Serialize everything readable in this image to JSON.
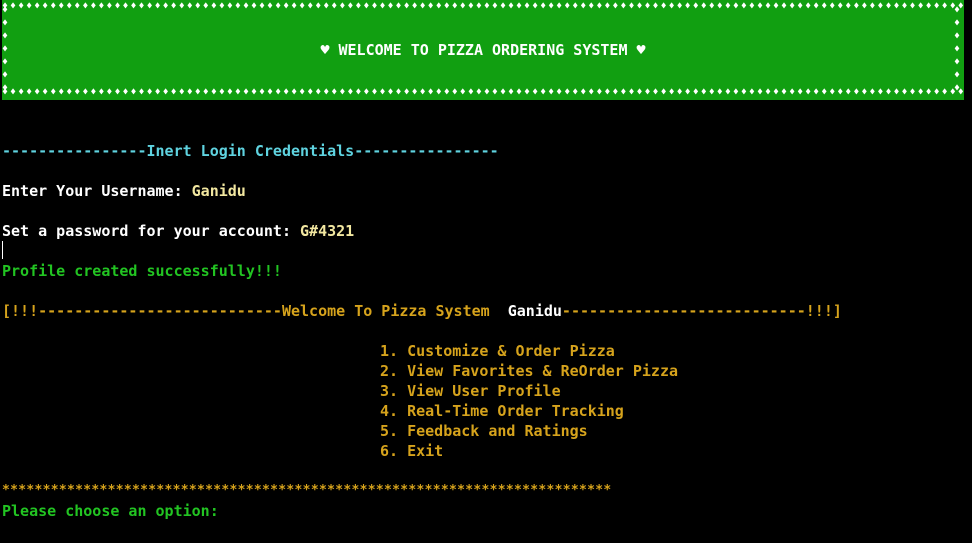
{
  "banner": {
    "title": "♥ WELCOME TO PIZZA ORDERING SYSTEM ♥",
    "border_glyph": "♦",
    "background": "#119f11"
  },
  "login_header": {
    "left_dashes": "----------------",
    "title": "Inert Login Credentials",
    "right_dashes": "----------------"
  },
  "username": {
    "prompt": "Enter Your Username: ",
    "value": "Ganidu"
  },
  "password": {
    "prompt": "Set a password for your account: ",
    "value": "G#4321"
  },
  "profile_status": "Profile created successfully!!!",
  "welcome_line": {
    "left": "[!!!---------------------------Welcome To Pizza System  ",
    "username": "Ganidu",
    "right": "---------------------------!!!]"
  },
  "menu": {
    "items": [
      "1. Customize & Order Pizza",
      "2. View Favorites & ReOrder Pizza",
      "3. View User Profile",
      "4. Real-Time Order Tracking",
      "5. Feedback and Ratings",
      "6. Exit"
    ]
  },
  "separator": "***************************************************************************",
  "choose_prompt": "Please choose an option:",
  "colors": {
    "cyan": "#5fd3e0",
    "green": "#22c422",
    "gold": "#d6a31c",
    "yellow": "#f2e7a0"
  }
}
